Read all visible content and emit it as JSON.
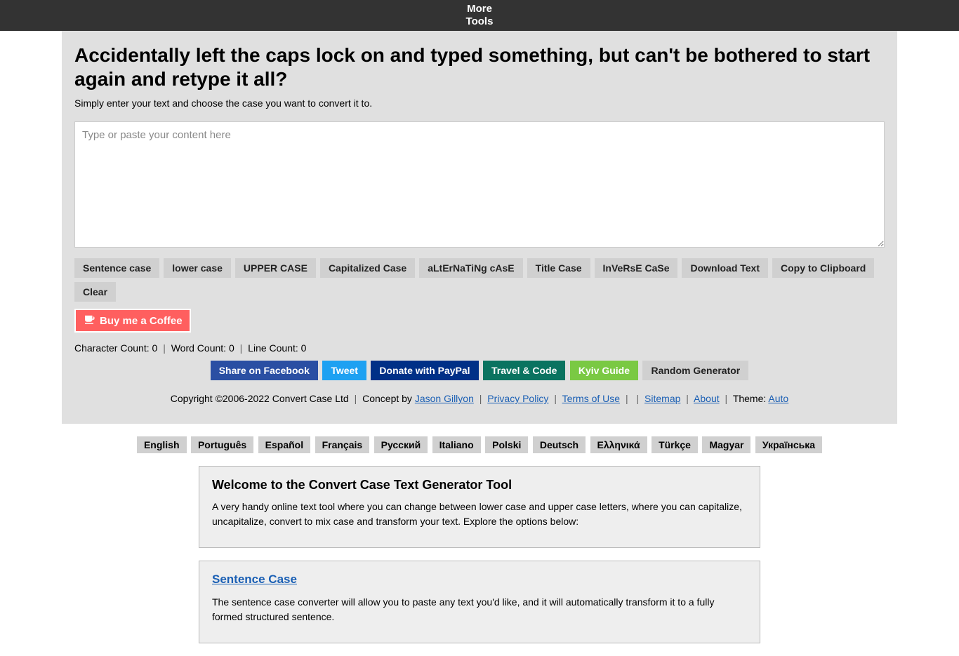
{
  "topbar": {
    "line1": "More",
    "line2": "Tools"
  },
  "heading": "Accidentally left the caps lock on and typed something, but can't be bothered to start again and retype it all?",
  "subtitle": "Simply enter your text and choose the case you want to convert it to.",
  "textarea": {
    "placeholder": "Type or paste your content here",
    "value": ""
  },
  "buttons": {
    "sentence": "Sentence case",
    "lower": "lower case",
    "upper": "UPPER CASE",
    "capitalized": "Capitalized Case",
    "alternating": "aLtErNaTiNg cAsE",
    "title": "Title Case",
    "inverse": "InVeRsE CaSe",
    "download": "Download Text",
    "copy": "Copy to Clipboard",
    "clear": "Clear"
  },
  "coffee": "Buy me a Coffee",
  "counts": {
    "char_label": "Character Count:",
    "char": "0",
    "word_label": "Word Count:",
    "word": "0",
    "line_label": "Line Count:",
    "line": "0"
  },
  "share": {
    "facebook": "Share on Facebook",
    "tweet": "Tweet",
    "paypal": "Donate with PayPal",
    "travel": "Travel & Code",
    "kyiv": "Kyiv Guide",
    "random": "Random Generator"
  },
  "footer": {
    "copyright": "Copyright ©2006-2022 Convert Case Ltd",
    "concept": "Concept by",
    "author": "Jason Gillyon",
    "privacy": "Privacy Policy",
    "terms": "Terms of Use",
    "sitemap": "Sitemap",
    "about": "About",
    "theme_label": "Theme:",
    "theme": "Auto"
  },
  "languages": [
    "English",
    "Português",
    "Español",
    "Français",
    "Русский",
    "Italiano",
    "Polski",
    "Deutsch",
    "Ελληνικά",
    "Türkçe",
    "Magyar",
    "Українська"
  ],
  "welcome": {
    "title": "Welcome to the Convert Case Text Generator Tool",
    "body": "A very handy online text tool where you can change between lower case and upper case letters, where you can capitalize, uncapitalize, convert to mix case and transform your text. Explore the options below:"
  },
  "section_sentence": {
    "title": "Sentence Case",
    "p1": "The sentence case converter will allow you to paste any text you'd like, and it will automatically transform it to a fully formed structured sentence."
  }
}
